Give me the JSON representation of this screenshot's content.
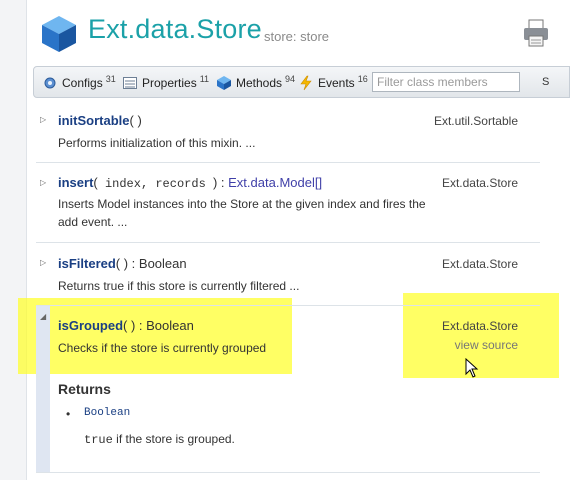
{
  "header": {
    "title": "Ext.data.Store",
    "alias": "store: store"
  },
  "toolbar": {
    "configs_label": "Configs",
    "configs_count": "31",
    "properties_label": "Properties",
    "properties_count": "11",
    "methods_label": "Methods",
    "methods_count": "94",
    "events_label": "Events",
    "events_count": "16",
    "filter_placeholder": "Filter class members",
    "trailing": "S"
  },
  "members": [
    {
      "name": "initSortable",
      "params": "( )",
      "returns": "",
      "owner": "Ext.util.Sortable",
      "desc": "Performs initialization of this mixin. ..."
    },
    {
      "name": "insert",
      "params_open": "(",
      "params": " index, records ",
      "params_close": ") : ",
      "returns": "Ext.data.Model[]",
      "owner": "Ext.data.Store",
      "desc": "Inserts Model instances into the Store at the given index and fires the add event. ..."
    },
    {
      "name": "isFiltered",
      "params": "( ) : ",
      "returns": "Boolean",
      "owner": "Ext.data.Store",
      "desc": "Returns true if this store is currently filtered ..."
    },
    {
      "name": "isGrouped",
      "params": "( ) : ",
      "returns": "Boolean",
      "owner": "Ext.data.Store",
      "view_source": "view source",
      "desc": "Checks if the store is currently grouped"
    }
  ],
  "returns_section": {
    "heading": "Returns",
    "type": "Boolean",
    "desc_code": "true",
    "desc_text": " if the store is grouped."
  },
  "colors": {
    "title": "#1ba1a8",
    "member_name": "#1a3f83",
    "highlight": "#ffff28"
  }
}
